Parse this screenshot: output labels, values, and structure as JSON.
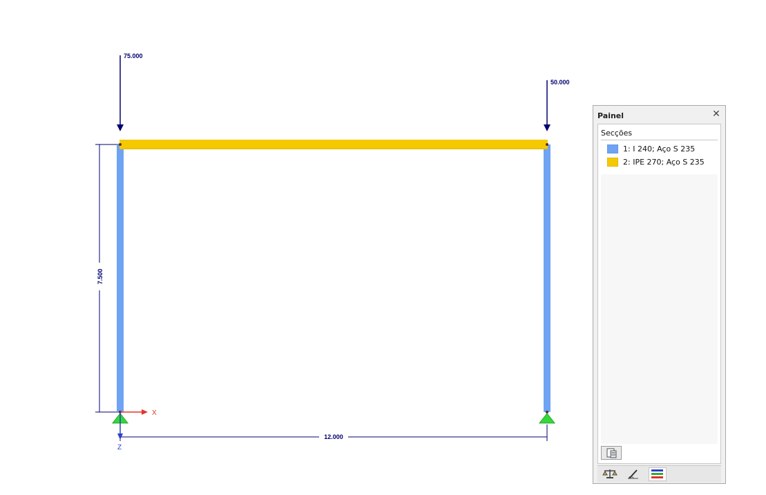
{
  "structure": {
    "loads": [
      {
        "node": 1,
        "value": "75.000"
      },
      {
        "node": 2,
        "value": "50.000"
      }
    ],
    "dimensions": {
      "height": "7.500",
      "span": "12.000"
    },
    "axes": {
      "x_label": "X",
      "z_label": "Z"
    },
    "colors": {
      "column": "#6fa3f3",
      "beam": "#f4c900",
      "dimension": "#00006e",
      "support": "#35d83a",
      "axis_x": "#e3332c",
      "axis_z": "#2a40c8"
    }
  },
  "panel": {
    "title": "Painel",
    "close_icon": "close-icon",
    "heading": "Secções",
    "sections": [
      {
        "label": "1: I 240; Aço S 235",
        "color": "#6fa3f3"
      },
      {
        "label": "2: IPE 270; Aço S 235",
        "color": "#f4c900"
      }
    ],
    "export_button_icon": "export-table-icon",
    "tabs": [
      {
        "icon": "scale-icon"
      },
      {
        "icon": "pencil-ruler-icon"
      },
      {
        "icon": "color-bars-icon"
      }
    ],
    "active_tab": 2
  }
}
